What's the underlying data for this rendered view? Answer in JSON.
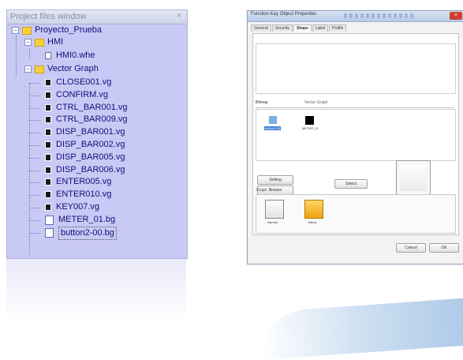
{
  "project_window": {
    "title": "Project files window",
    "close_glyph": "×",
    "root": "Proyecto_Prueba",
    "hmi_folder": "HMI",
    "hmi_file": "HMI0.whe",
    "vector_folder": "Vector Graph",
    "files": [
      "CLOSE001.vg",
      "CONFIRM.vg",
      "CTRL_BAR001.vg",
      "CTRL_BAR009.vg",
      "DISP_BAR001.vg",
      "DISP_BAR002.vg",
      "DISP_BAR005.vg",
      "DISP_BAR006.vg",
      "ENTER005.vg",
      "ENTER010.vg",
      "KEY007.vg"
    ],
    "bitmap_files": [
      "METER_01.bg",
      "button2-00.bg"
    ],
    "expand_glyph": "−"
  },
  "dialog": {
    "title": "Function Key Object Properties",
    "close_glyph": "×",
    "tabs": [
      "General",
      "Security",
      "Shape",
      "Label",
      "Profile"
    ],
    "bitmap_section_label": "Bitmap",
    "vector_section_label": "Vector Graph",
    "swatch_labels": [
      "button2-00",
      "METER_01"
    ],
    "buttons": {
      "setting": "Setting",
      "browse": "Browse",
      "select": "Select",
      "cancel": "Cancel",
      "ok": "OK"
    },
    "group_label": "Shape",
    "options": [
      "Normal",
      "Yellow"
    ]
  }
}
